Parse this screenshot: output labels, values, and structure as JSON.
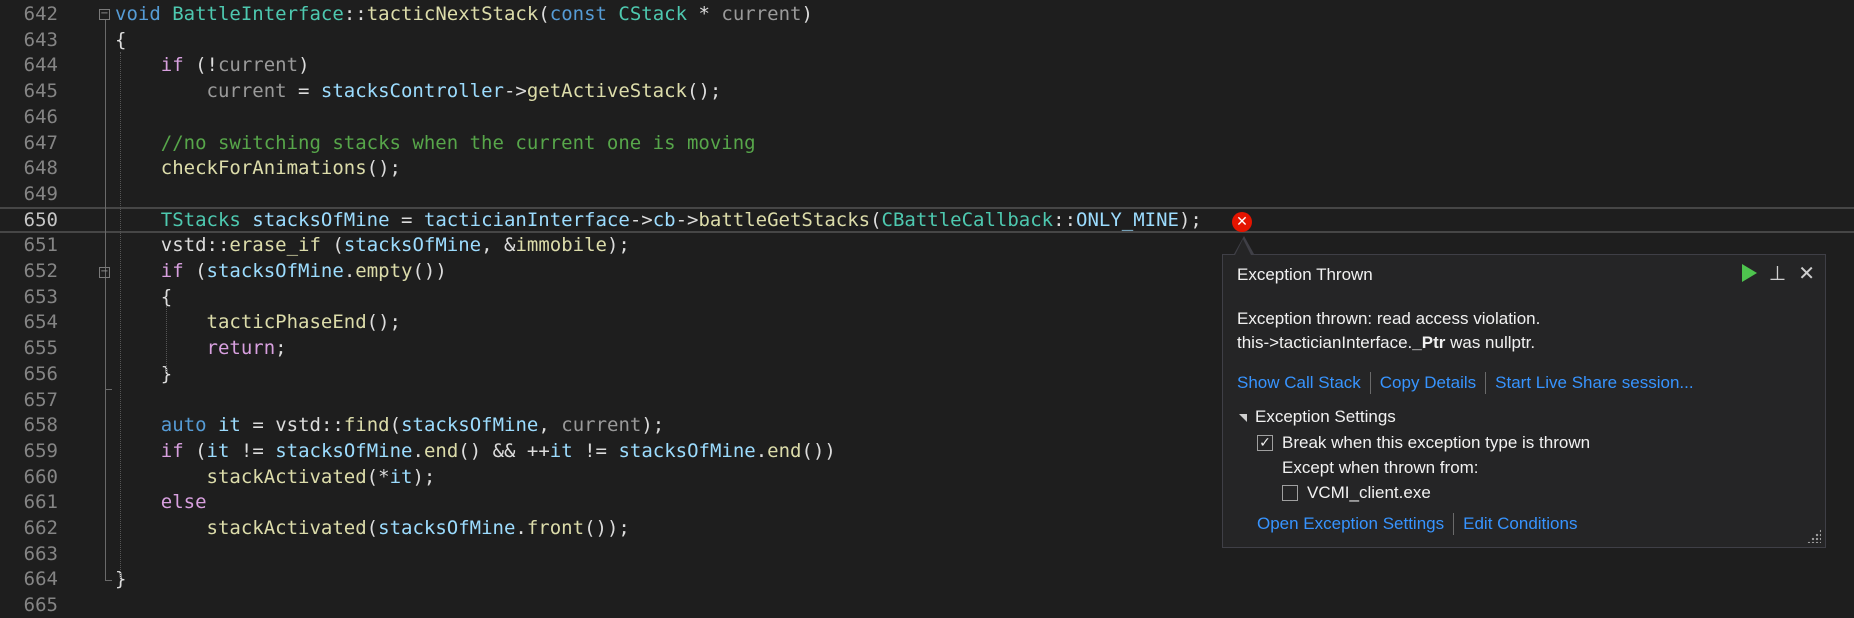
{
  "editor": {
    "lines": [
      {
        "n": "642",
        "tokens": [
          [
            "kw",
            "void"
          ],
          [
            "tx",
            " "
          ],
          [
            "ty",
            "BattleInterface"
          ],
          [
            "tx",
            "::"
          ],
          [
            "fn",
            "tacticNextStack"
          ],
          [
            "tx",
            "("
          ],
          [
            "kw",
            "const"
          ],
          [
            "tx",
            " "
          ],
          [
            "ty",
            "CStack"
          ],
          [
            "tx",
            " * "
          ],
          [
            "par",
            "current"
          ],
          [
            "tx",
            ")"
          ]
        ]
      },
      {
        "n": "643",
        "tokens": [
          [
            "tx",
            "{"
          ]
        ]
      },
      {
        "n": "644",
        "tokens": [
          [
            "tx",
            "    "
          ],
          [
            "ctl",
            "if"
          ],
          [
            "tx",
            " (!"
          ],
          [
            "par",
            "current"
          ],
          [
            "tx",
            ")"
          ]
        ]
      },
      {
        "n": "645",
        "tokens": [
          [
            "tx",
            "        "
          ],
          [
            "par",
            "current"
          ],
          [
            "tx",
            " = "
          ],
          [
            "var",
            "stacksController"
          ],
          [
            "tx",
            "->"
          ],
          [
            "fn",
            "getActiveStack"
          ],
          [
            "tx",
            "();"
          ]
        ]
      },
      {
        "n": "646",
        "tokens": []
      },
      {
        "n": "647",
        "tokens": [
          [
            "tx",
            "    "
          ],
          [
            "cm",
            "//no switching stacks when the current one is moving"
          ]
        ]
      },
      {
        "n": "648",
        "tokens": [
          [
            "tx",
            "    "
          ],
          [
            "fn",
            "checkForAnimations"
          ],
          [
            "tx",
            "();"
          ]
        ]
      },
      {
        "n": "649",
        "tokens": []
      },
      {
        "n": "650",
        "tokens": [
          [
            "tx",
            "    "
          ],
          [
            "ty",
            "TStacks"
          ],
          [
            "tx",
            " "
          ],
          [
            "var",
            "stacksOfMine"
          ],
          [
            "tx",
            " = "
          ],
          [
            "var",
            "tacticianInterface"
          ],
          [
            "tx",
            "->"
          ],
          [
            "var",
            "cb"
          ],
          [
            "tx",
            "->"
          ],
          [
            "fn",
            "battleGetStacks"
          ],
          [
            "tx",
            "("
          ],
          [
            "ty",
            "CBattleCallback"
          ],
          [
            "tx",
            "::"
          ],
          [
            "var",
            "ONLY_MINE"
          ],
          [
            "tx",
            ");"
          ]
        ]
      },
      {
        "n": "651",
        "tokens": [
          [
            "tx",
            "    "
          ],
          [
            "tx",
            "vstd"
          ],
          [
            "tx",
            "::"
          ],
          [
            "fn",
            "erase_if"
          ],
          [
            "tx",
            " ("
          ],
          [
            "var",
            "stacksOfMine"
          ],
          [
            "tx",
            ", &"
          ],
          [
            "fn",
            "immobile"
          ],
          [
            "tx",
            ");"
          ]
        ]
      },
      {
        "n": "652",
        "tokens": [
          [
            "tx",
            "    "
          ],
          [
            "ctl",
            "if"
          ],
          [
            "tx",
            " ("
          ],
          [
            "var",
            "stacksOfMine"
          ],
          [
            "tx",
            "."
          ],
          [
            "fn",
            "empty"
          ],
          [
            "tx",
            "())"
          ]
        ]
      },
      {
        "n": "653",
        "tokens": [
          [
            "tx",
            "    {"
          ]
        ]
      },
      {
        "n": "654",
        "tokens": [
          [
            "tx",
            "        "
          ],
          [
            "fn",
            "tacticPhaseEnd"
          ],
          [
            "tx",
            "();"
          ]
        ]
      },
      {
        "n": "655",
        "tokens": [
          [
            "tx",
            "        "
          ],
          [
            "ctl",
            "return"
          ],
          [
            "tx",
            ";"
          ]
        ]
      },
      {
        "n": "656",
        "tokens": [
          [
            "tx",
            "    }"
          ]
        ]
      },
      {
        "n": "657",
        "tokens": []
      },
      {
        "n": "658",
        "tokens": [
          [
            "tx",
            "    "
          ],
          [
            "kw",
            "auto"
          ],
          [
            "tx",
            " "
          ],
          [
            "var",
            "it"
          ],
          [
            "tx",
            " = "
          ],
          [
            "tx",
            "vstd"
          ],
          [
            "tx",
            "::"
          ],
          [
            "fn",
            "find"
          ],
          [
            "tx",
            "("
          ],
          [
            "var",
            "stacksOfMine"
          ],
          [
            "tx",
            ", "
          ],
          [
            "par",
            "current"
          ],
          [
            "tx",
            ");"
          ]
        ]
      },
      {
        "n": "659",
        "tokens": [
          [
            "tx",
            "    "
          ],
          [
            "ctl",
            "if"
          ],
          [
            "tx",
            " ("
          ],
          [
            "var",
            "it"
          ],
          [
            "tx",
            " != "
          ],
          [
            "var",
            "stacksOfMine"
          ],
          [
            "tx",
            "."
          ],
          [
            "fn",
            "end"
          ],
          [
            "tx",
            "() && ++"
          ],
          [
            "var",
            "it"
          ],
          [
            "tx",
            " != "
          ],
          [
            "var",
            "stacksOfMine"
          ],
          [
            "tx",
            "."
          ],
          [
            "fn",
            "end"
          ],
          [
            "tx",
            "())"
          ]
        ]
      },
      {
        "n": "660",
        "tokens": [
          [
            "tx",
            "        "
          ],
          [
            "fn",
            "stackActivated"
          ],
          [
            "tx",
            "(*"
          ],
          [
            "var",
            "it"
          ],
          [
            "tx",
            ");"
          ]
        ]
      },
      {
        "n": "661",
        "tokens": [
          [
            "tx",
            "    "
          ],
          [
            "ctl",
            "else"
          ]
        ]
      },
      {
        "n": "662",
        "tokens": [
          [
            "tx",
            "        "
          ],
          [
            "fn",
            "stackActivated"
          ],
          [
            "tx",
            "("
          ],
          [
            "var",
            "stacksOfMine"
          ],
          [
            "tx",
            "."
          ],
          [
            "fn",
            "front"
          ],
          [
            "tx",
            "());"
          ]
        ]
      },
      {
        "n": "663",
        "tokens": []
      },
      {
        "n": "664",
        "tokens": [
          [
            "tx",
            "}"
          ]
        ]
      },
      {
        "n": "665",
        "tokens": []
      }
    ],
    "current_line": "650"
  },
  "popup": {
    "title": "Exception Thrown",
    "message_line1": "Exception thrown: read access violation.",
    "message_line2_prefix": "this->tacticianInterface.",
    "message_line2_bold": "_Ptr",
    "message_line2_suffix": " was nullptr.",
    "link_call_stack": "Show Call Stack",
    "link_copy_details": "Copy Details",
    "link_live_share": "Start Live Share session...",
    "settings_header": "Exception Settings",
    "break_label": "Break when this exception type is thrown",
    "break_checked": true,
    "except_label": "Except when thrown from:",
    "module_label": "VCMI_client.exe",
    "module_checked": false,
    "link_open_settings": "Open Exception Settings",
    "link_edit_conditions": "Edit Conditions"
  },
  "icons": {
    "error": "error-circle-icon",
    "continue": "play-icon",
    "pin": "pin-icon",
    "close": "close-icon"
  },
  "colors": {
    "background": "#1e1e1e",
    "error": "#e51400",
    "link": "#3794ff",
    "continue": "#4ec44e"
  }
}
